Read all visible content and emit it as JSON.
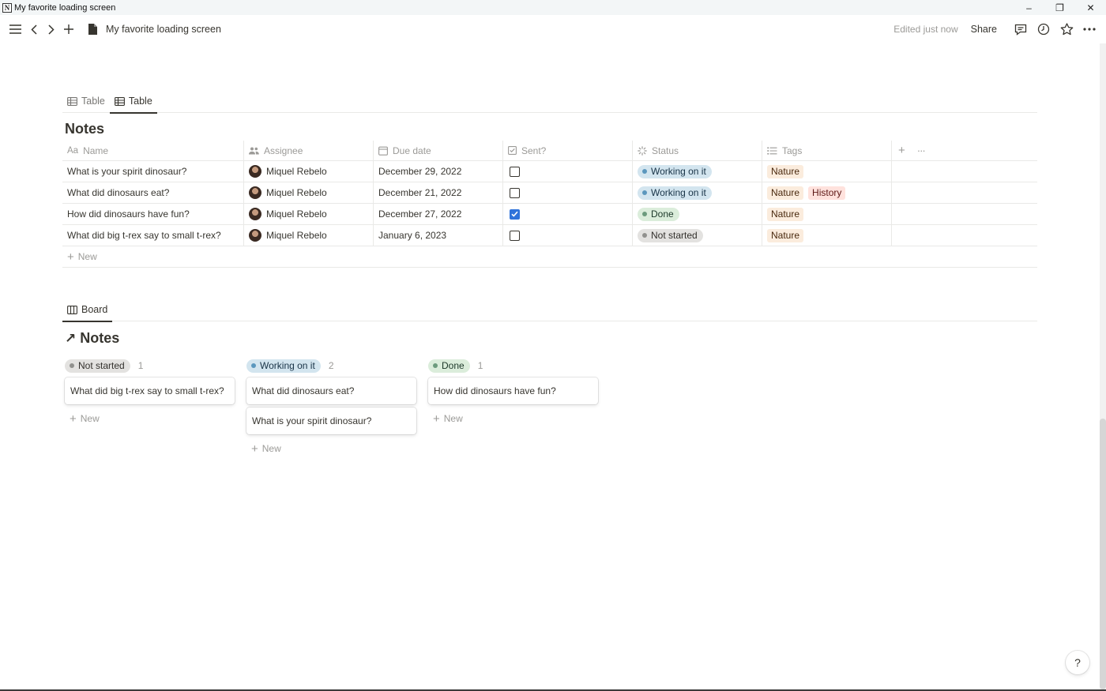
{
  "window": {
    "title": "My favorite loading screen",
    "app_icon_letter": "N",
    "min": "–",
    "max": "❐",
    "close": "✕"
  },
  "topbar": {
    "breadcrumb": "My favorite loading screen",
    "edited": "Edited just now",
    "share": "Share"
  },
  "table_section": {
    "tabs": [
      {
        "label": "Table",
        "active": false
      },
      {
        "label": "Table",
        "active": true
      }
    ],
    "title": "Notes",
    "columns": {
      "name": "Name",
      "name_prefix": "Aa",
      "assignee": "Assignee",
      "due_date": "Due date",
      "sent": "Sent?",
      "status": "Status",
      "tags": "Tags"
    },
    "add_column": "+",
    "more": "···",
    "rows": [
      {
        "name": "What is your spirit dinosaur?",
        "assignee": "Miquel Rebelo",
        "due": "December 29, 2022",
        "sent": false,
        "status": "Working on it",
        "tags": [
          "Nature"
        ]
      },
      {
        "name": "What did dinosaurs eat?",
        "assignee": "Miquel Rebelo",
        "due": "December 21, 2022",
        "sent": false,
        "status": "Working on it",
        "tags": [
          "Nature",
          "History"
        ]
      },
      {
        "name": "How did dinosaurs have fun?",
        "assignee": "Miquel Rebelo",
        "due": "December 27, 2022",
        "sent": true,
        "status": "Done",
        "tags": [
          "Nature"
        ]
      },
      {
        "name": "What did big t-rex say to small t-rex?",
        "assignee": "Miquel Rebelo",
        "due": "January 6, 2023",
        "sent": false,
        "status": "Not started",
        "tags": [
          "Nature"
        ]
      }
    ],
    "new_label": "New"
  },
  "board_section": {
    "tab": "Board",
    "title": "Notes",
    "title_arrow": "↗",
    "columns": [
      {
        "status": "Not started",
        "count": "1",
        "cards": [
          "What did big t-rex say to small t-rex?"
        ]
      },
      {
        "status": "Working on it",
        "count": "2",
        "cards": [
          "What did dinosaurs eat?",
          "What is your spirit dinosaur?"
        ]
      },
      {
        "status": "Done",
        "count": "1",
        "cards": [
          "How did dinosaurs have fun?"
        ]
      }
    ],
    "new_label": "New"
  },
  "help": "?",
  "colors": {
    "not_started_bg": "#e3e2e0",
    "not_started_dot": "#91918e",
    "not_started_text": "#32302c",
    "working_bg": "#d3e5ef",
    "working_dot": "#5b97bd",
    "working_text": "#183347",
    "done_bg": "#dbeddb",
    "done_dot": "#6c9b7d",
    "done_text": "#1c3829",
    "nature_bg": "#fbecdd",
    "nature_text": "#49290e",
    "history_bg": "#ffe2dd",
    "history_text": "#5d1715",
    "checked": "#2f73da"
  }
}
